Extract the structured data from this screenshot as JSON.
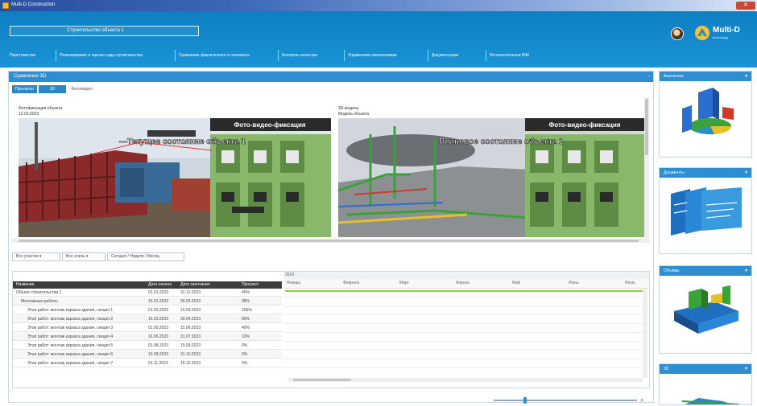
{
  "window": {
    "title": "Multi-D Construction",
    "minimize": "–",
    "maximize": "□",
    "close": "✕"
  },
  "header": {
    "project_value": "Строительство объекта 1",
    "logo_text": "Multi-D",
    "logo_sub": "technology",
    "nav": [
      "Пространство",
      "Планирование и оценка хода строительства",
      "Сравнение фактического и планового",
      "Контроль качества",
      "Управление изменениями",
      "Документация",
      "Исполнительная BIM"
    ]
  },
  "panel": {
    "title": "Сравнение 3D",
    "collapse": "–",
    "tabs": [
      "Просмотр",
      "3D",
      "Фото/видео"
    ]
  },
  "viewport": {
    "left_caption": "Фотофиксация объекта",
    "left_subcaption": "12.03.2023",
    "right_caption": "3D-модель",
    "right_subcaption": "Модель объекта"
  },
  "filters": [
    "Все участки ▾",
    "Все этапы ▾",
    "Сегодня / Неделя / Месяц"
  ],
  "gantt": {
    "headers": [
      "Название",
      "Дата начала",
      "Дата окончания",
      "Прогресс"
    ],
    "timeline_title": "2023",
    "months": [
      "Январь",
      "Февраль",
      "Март",
      "Апрель",
      "Май",
      "Июнь",
      "Июль"
    ],
    "rows": [
      {
        "name": "Объект строительства 1",
        "start": "01.01.2023",
        "end": "31.12.2023",
        "progress": "45%"
      },
      {
        "name": "Монтажные работы",
        "start": "15.01.2023",
        "end": "30.06.2023",
        "progress": "38%"
      },
      {
        "name": "Этап работ: монтаж каркаса здания, секция 1",
        "start": "01.02.2023",
        "end": "15.03.2023",
        "progress": "100%"
      },
      {
        "name": "Этап работ: монтаж каркаса здания, секция 2",
        "start": "16.03.2023",
        "end": "30.04.2023",
        "progress": "80%"
      },
      {
        "name": "Этап работ: монтаж каркаса здания, секция 3",
        "start": "01.05.2023",
        "end": "15.06.2023",
        "progress": "40%"
      },
      {
        "name": "Этап работ: монтаж каркаса здания, секция 4",
        "start": "16.06.2023",
        "end": "31.07.2023",
        "progress": "10%"
      },
      {
        "name": "Этап работ: монтаж каркаса здания, секция 5",
        "start": "01.08.2023",
        "end": "15.09.2023",
        "progress": "0%"
      },
      {
        "name": "Этап работ: монтаж каркаса здания, секция 6",
        "start": "16.09.2023",
        "end": "31.10.2023",
        "progress": "0%"
      },
      {
        "name": "Этап работ: монтаж каркаса здания, секция 7",
        "start": "01.11.2023",
        "end": "15.12.2023",
        "progress": "0%"
      }
    ]
  },
  "zoom": {
    "level": 0.21,
    "icon": "zoom-icon"
  },
  "sidebar": [
    {
      "label": "Аналитика",
      "toggle": "▾"
    },
    {
      "label": "Документы",
      "toggle": "▾"
    },
    {
      "label": "Объёмы",
      "toggle": "▾"
    },
    {
      "label": "3D",
      "toggle": "▾"
    }
  ],
  "colors": {
    "header": "#1a8fd2",
    "panel": "#2e8ed0",
    "progress": "#8ccf2e"
  }
}
